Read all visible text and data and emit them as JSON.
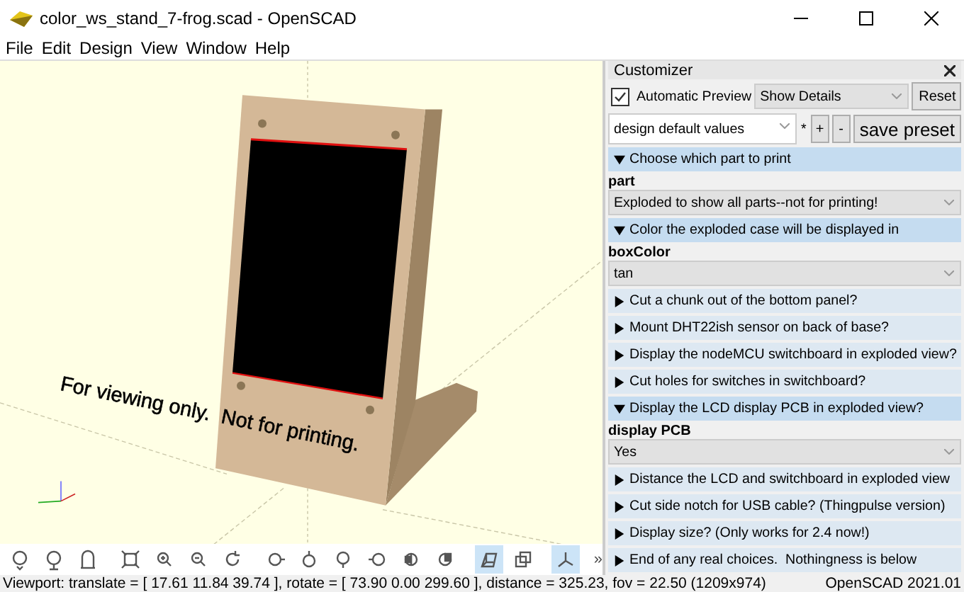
{
  "window": {
    "title": "color_ws_stand_7-frog.scad - OpenSCAD"
  },
  "menu": [
    "File",
    "Edit",
    "Design",
    "View",
    "Window",
    "Help"
  ],
  "viewport": {
    "overlay_text": "For viewing only.  Not for printing."
  },
  "toolbar": [
    {
      "kind": "preview",
      "selected": false
    },
    {
      "kind": "render",
      "selected": false
    },
    {
      "kind": "export",
      "selected": false
    },
    {
      "kind": "view-all",
      "selected": false
    },
    {
      "kind": "zoom-in",
      "selected": false
    },
    {
      "kind": "zoom-out",
      "selected": false
    },
    {
      "kind": "reset-view",
      "selected": false
    },
    {
      "kind": "view-right",
      "selected": false
    },
    {
      "kind": "view-top",
      "selected": false
    },
    {
      "kind": "view-bottom",
      "selected": false
    },
    {
      "kind": "view-left",
      "selected": false
    },
    {
      "kind": "view-front",
      "selected": false
    },
    {
      "kind": "view-back",
      "selected": false
    },
    {
      "kind": "perspective",
      "selected": true
    },
    {
      "kind": "orthogonal",
      "selected": false
    },
    {
      "kind": "axes",
      "selected": true
    }
  ],
  "toolbar_overflow": "»",
  "customizer": {
    "title": "Customizer",
    "automatic_preview": {
      "label": "Automatic Preview",
      "checked": true
    },
    "details": "Show Details",
    "reset": "Reset",
    "preset": "design default values",
    "preset_modified": "*",
    "add": "+",
    "remove": "-",
    "save": "save preset",
    "groups": [
      {
        "title": "Choose which part to print",
        "expanded": true,
        "params": [
          {
            "name": "part",
            "value": "Exploded to show all parts--not for printing!"
          }
        ]
      },
      {
        "title": "Color the exploded case will be displayed in",
        "expanded": true,
        "params": [
          {
            "name": "boxColor",
            "value": "tan"
          }
        ]
      },
      {
        "title": "Cut a chunk out of the bottom panel?",
        "expanded": false
      },
      {
        "title": "Mount DHT22ish sensor on back of base?",
        "expanded": false
      },
      {
        "title": "Display the nodeMCU switchboard in exploded view?",
        "expanded": false
      },
      {
        "title": "Cut holes for switches in switchboard?",
        "expanded": false
      },
      {
        "title": "Display the LCD display PCB in exploded view?",
        "expanded": true,
        "params": [
          {
            "name": "display PCB",
            "value": "Yes"
          }
        ]
      },
      {
        "title": "Distance the LCD and switchboard in exploded view",
        "expanded": false
      },
      {
        "title": "Cut side notch for USB cable? (Thingpulse version)",
        "expanded": false
      },
      {
        "title": "Display size? (Only works for 2.4 now!)",
        "expanded": false
      },
      {
        "title": "End of any real choices.  Nothingness is below",
        "expanded": false
      }
    ]
  },
  "status_bar": {
    "viewport": "Viewport: translate = [ 17.61 11.84 39.74 ], rotate = [ 73.90 0.00 299.60 ], distance = 325.23, fov = 22.50 (1209x974)",
    "version": "OpenSCAD 2021.01"
  }
}
